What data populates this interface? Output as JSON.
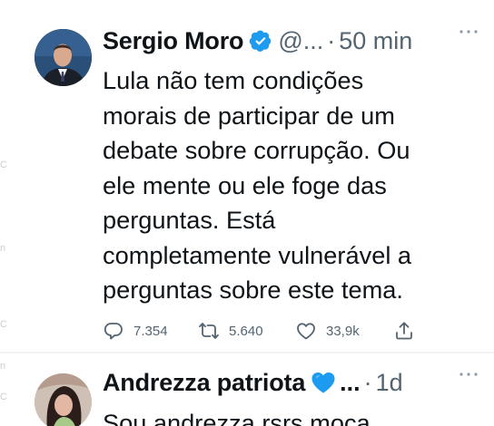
{
  "tweets": [
    {
      "author_name": "Sergio Moro",
      "handle": "@...",
      "separator": "·",
      "time": "50 min",
      "verified_badge": "verified-badge-icon",
      "text": "Lula não tem condições\nmorais de participar de um\ndebate sobre corrupção. Ou\nele mente ou ele foge das\nperguntas. Está\ncompletamente vulnerável a\nperguntas sobre este tema.",
      "replies": "7.354",
      "retweets": "5.640",
      "likes": "33,9k"
    },
    {
      "author_name": "Andrezza patriota",
      "name_badge": "blue-heart-icon",
      "ellipsis": "...",
      "separator": "·",
      "time": "1d",
      "text": "Sou andrezza rsrs moça"
    }
  ],
  "colors": {
    "text": "#0f1419",
    "secondary": "#536471",
    "verified": "#1d9bf0",
    "heart": "#1d9bf0",
    "divider": "#eff3f4"
  },
  "edge_fragments": [
    "C",
    "n",
    "C",
    "n",
    "C"
  ]
}
